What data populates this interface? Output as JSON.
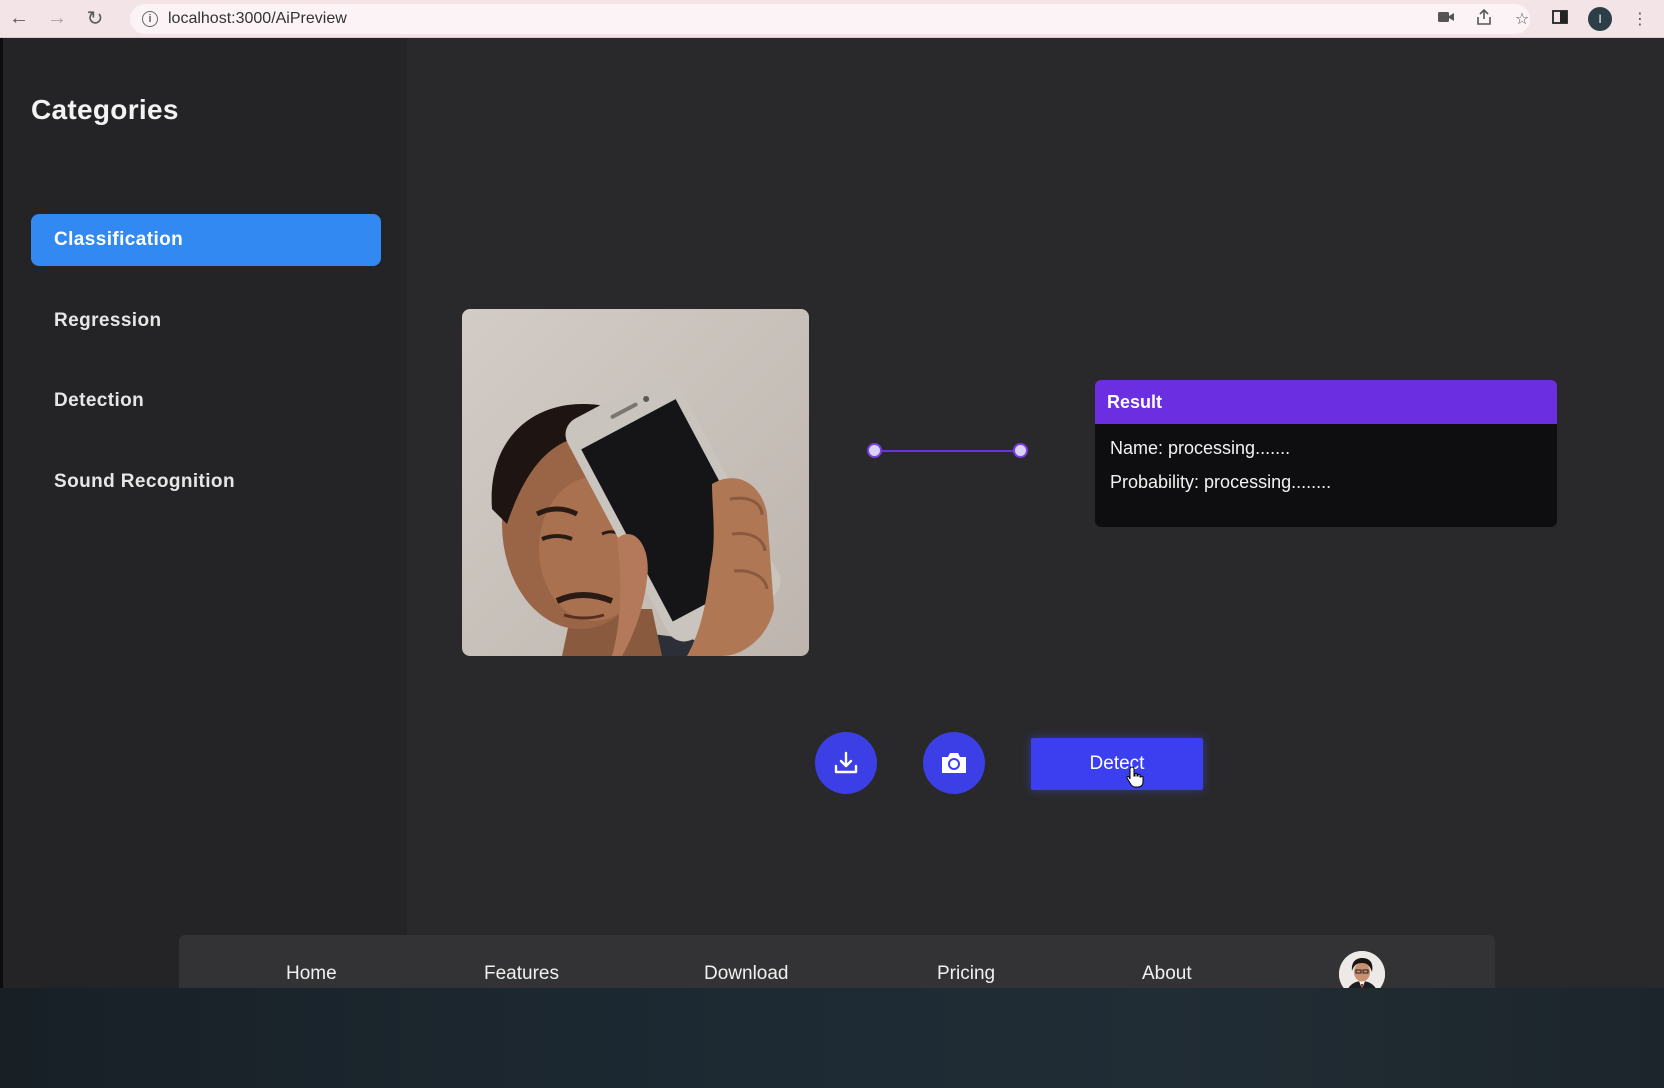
{
  "browser": {
    "url": "localhost:3000/AiPreview",
    "profile_initial": "I"
  },
  "sidebar": {
    "title": "Categories",
    "items": [
      {
        "label": "Classification",
        "active": true
      },
      {
        "label": "Regression",
        "active": false
      },
      {
        "label": "Detection",
        "active": false
      },
      {
        "label": "Sound Recognition",
        "active": false
      }
    ]
  },
  "result": {
    "title": "Result",
    "name_label": "Name:",
    "name_value": "processing.......",
    "probability_label": "Probability:",
    "probability_value": "processing........"
  },
  "actions": {
    "detect_label": "Detect"
  },
  "bottom_nav": {
    "links": [
      "Home",
      "Features",
      "Download",
      "Pricing",
      "About"
    ]
  },
  "colors": {
    "sidebar_active": "#3289f2",
    "result_header": "#6c2ee1",
    "action_buttons": "#3c3fe6",
    "app_background": "#29292b",
    "sidebar_background": "#242426"
  }
}
